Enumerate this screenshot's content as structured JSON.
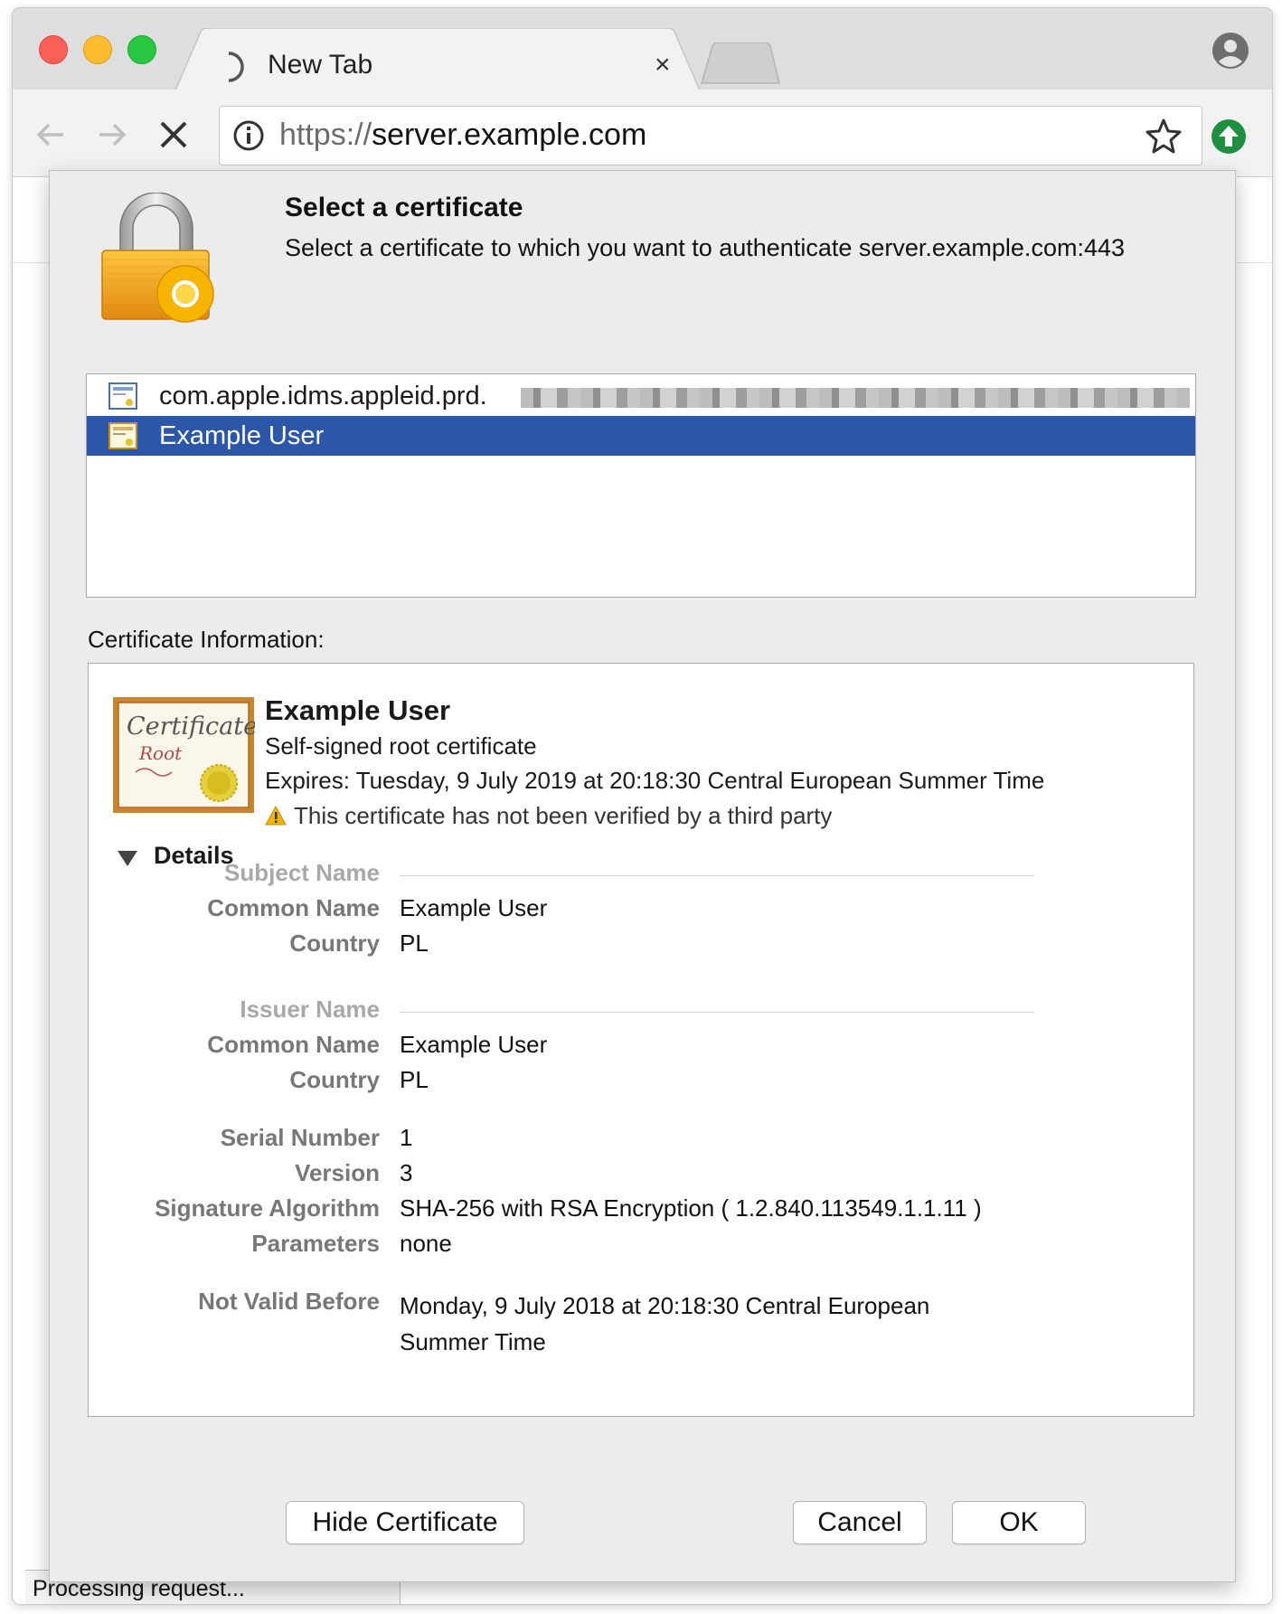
{
  "browser": {
    "tab_title": "New Tab",
    "tab_close": "×",
    "url_scheme": "https://",
    "url_host": "server.example.com"
  },
  "dialog": {
    "title": "Select a certificate",
    "subtitle": "Select a certificate to which you want to authenticate server.example.com:443",
    "certificates": [
      {
        "label": "com.apple.idms.appleid.prd.",
        "redacted": true,
        "selected": false
      },
      {
        "label": "Example User",
        "selected": true
      }
    ],
    "info_label": "Certificate Information:",
    "cert": {
      "name": "Example User",
      "type": "Self-signed root certificate",
      "expires": "Expires: Tuesday, 9 July 2019 at 20:18:30 Central European Summer Time",
      "warning": "This certificate has not been verified by a third party",
      "details_label": "Details",
      "details": {
        "subject_section": "Subject Name",
        "subject_cn_key": "Common Name",
        "subject_cn_val": "Example User",
        "subject_country_key": "Country",
        "subject_country_val": "PL",
        "issuer_section": "Issuer Name",
        "issuer_cn_key": "Common Name",
        "issuer_cn_val": "Example User",
        "issuer_country_key": "Country",
        "issuer_country_val": "PL",
        "serial_key": "Serial Number",
        "serial_val": "1",
        "version_key": "Version",
        "version_val": "3",
        "sigalg_key": "Signature Algorithm",
        "sigalg_val": "SHA-256 with RSA Encryption ( 1.2.840.113549.1.1.11 )",
        "params_key": "Parameters",
        "params_val": "none",
        "notbefore_key": "Not Valid Before",
        "notbefore_val": "Monday, 9 July 2018 at 20:18:30 Central European Summer Time"
      }
    },
    "buttons": {
      "hide": "Hide Certificate",
      "cancel": "Cancel",
      "ok": "OK"
    }
  },
  "status": "Processing request...",
  "colors": {
    "selection": "#2c57a8",
    "lock_gold": "#f2a623",
    "extension_green": "#1e8f3e"
  },
  "icons": [
    "loading-spinner-icon",
    "close-icon",
    "back-arrow-icon",
    "forward-arrow-icon",
    "stop-icon",
    "info-icon",
    "star-icon",
    "extension-update-icon",
    "profile-icon",
    "lock-icon",
    "certificate-icon",
    "warning-icon",
    "disclosure-triangle-icon"
  ]
}
